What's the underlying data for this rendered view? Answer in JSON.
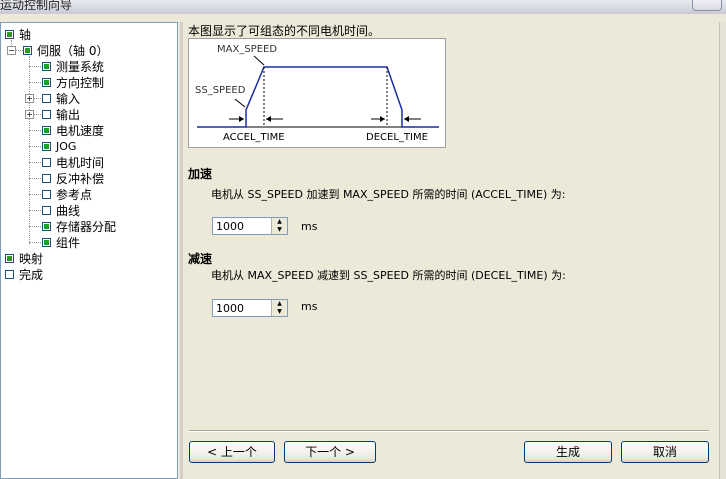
{
  "window": {
    "title": "运动控制向导"
  },
  "tree": {
    "items": [
      {
        "label": "轴",
        "checked": true
      },
      {
        "label": "伺服（轴 0）",
        "checked": true
      },
      {
        "label": "测量系统",
        "checked": true
      },
      {
        "label": "方向控制",
        "checked": true
      },
      {
        "label": "输入",
        "checked": false
      },
      {
        "label": "输出",
        "checked": false
      },
      {
        "label": "电机速度",
        "checked": true
      },
      {
        "label": "JOG",
        "checked": true
      },
      {
        "label": "电机时间",
        "checked": false
      },
      {
        "label": "反冲补偿",
        "checked": false
      },
      {
        "label": "参考点",
        "checked": false
      },
      {
        "label": "曲线",
        "checked": false
      },
      {
        "label": "存储器分配",
        "checked": true
      },
      {
        "label": "组件",
        "checked": true
      },
      {
        "label": "映射",
        "checked": true
      },
      {
        "label": "完成",
        "checked": false
      }
    ]
  },
  "panel": {
    "description": "本图显示了可组态的不同电机时间。",
    "diagram": {
      "max_speed": "MAX_SPEED",
      "ss_speed": "SS_SPEED",
      "accel_time": "ACCEL_TIME",
      "decel_time": "DECEL_TIME"
    },
    "accel": {
      "heading": "加速",
      "text": "电机从 SS_SPEED 加速到 MAX_SPEED 所需的时间 (ACCEL_TIME) 为:",
      "value": "1000",
      "unit": "ms"
    },
    "decel": {
      "heading": "减速",
      "text": "电机从 MAX_SPEED 减速到 SS_SPEED 所需的时间 (DECEL_TIME) 为:",
      "value": "1000",
      "unit": "ms"
    }
  },
  "buttons": {
    "prev": "< 上一个",
    "next": "下一个 >",
    "generate": "生成",
    "cancel": "取消"
  },
  "colors": {
    "check_green": "#21a121",
    "curve_blue": "#1a2ea0"
  }
}
